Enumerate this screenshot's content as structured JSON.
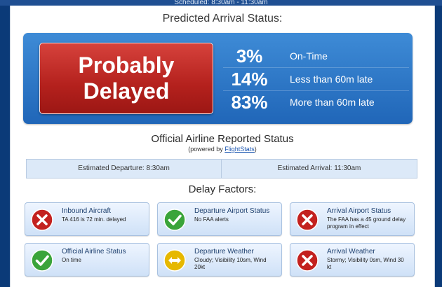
{
  "top_strip": "Scheduled: 8:30am - 11:30am",
  "predicted": {
    "heading": "Predicted Arrival Status:",
    "status": "Probably Delayed",
    "stats": [
      {
        "pct": "3%",
        "label": "On-Time"
      },
      {
        "pct": "14%",
        "label": "Less than 60m late"
      },
      {
        "pct": "83%",
        "label": "More than 60m late"
      }
    ]
  },
  "official": {
    "heading": "Official Airline Reported Status",
    "powered_prefix": "(powered by ",
    "powered_link": "FlightStats",
    "powered_suffix": ")",
    "est_departure": "Estimated Departure: 8:30am",
    "est_arrival": "Estimated Arrival: 11:30am"
  },
  "delay": {
    "heading": "Delay Factors:",
    "factors": [
      {
        "title": "Inbound Aircraft",
        "desc": "TA 416 is 72 min. delayed",
        "icon": "x-icon"
      },
      {
        "title": "Departure Airport Status",
        "desc": "No FAA alerts",
        "icon": "check-icon"
      },
      {
        "title": "Arrival Airport Status",
        "desc": "The FAA has a 45 ground delay program in effect",
        "icon": "x-icon"
      },
      {
        "title": "Official Airline Status",
        "desc": "On time",
        "icon": "check-icon"
      },
      {
        "title": "Departure Weather",
        "desc": "Cloudy; Visibility 10sm, Wind 20kt",
        "icon": "arrows-icon"
      },
      {
        "title": "Arrival Weather",
        "desc": "Stormy; Visibility 0sm, Wind 30 kt",
        "icon": "x-icon"
      }
    ]
  },
  "colors": {
    "delayed_red": "#b4211d",
    "panel_blue": "#2f7ac8",
    "ok_green": "#3aa43a",
    "warn_yellow": "#e6b800"
  }
}
